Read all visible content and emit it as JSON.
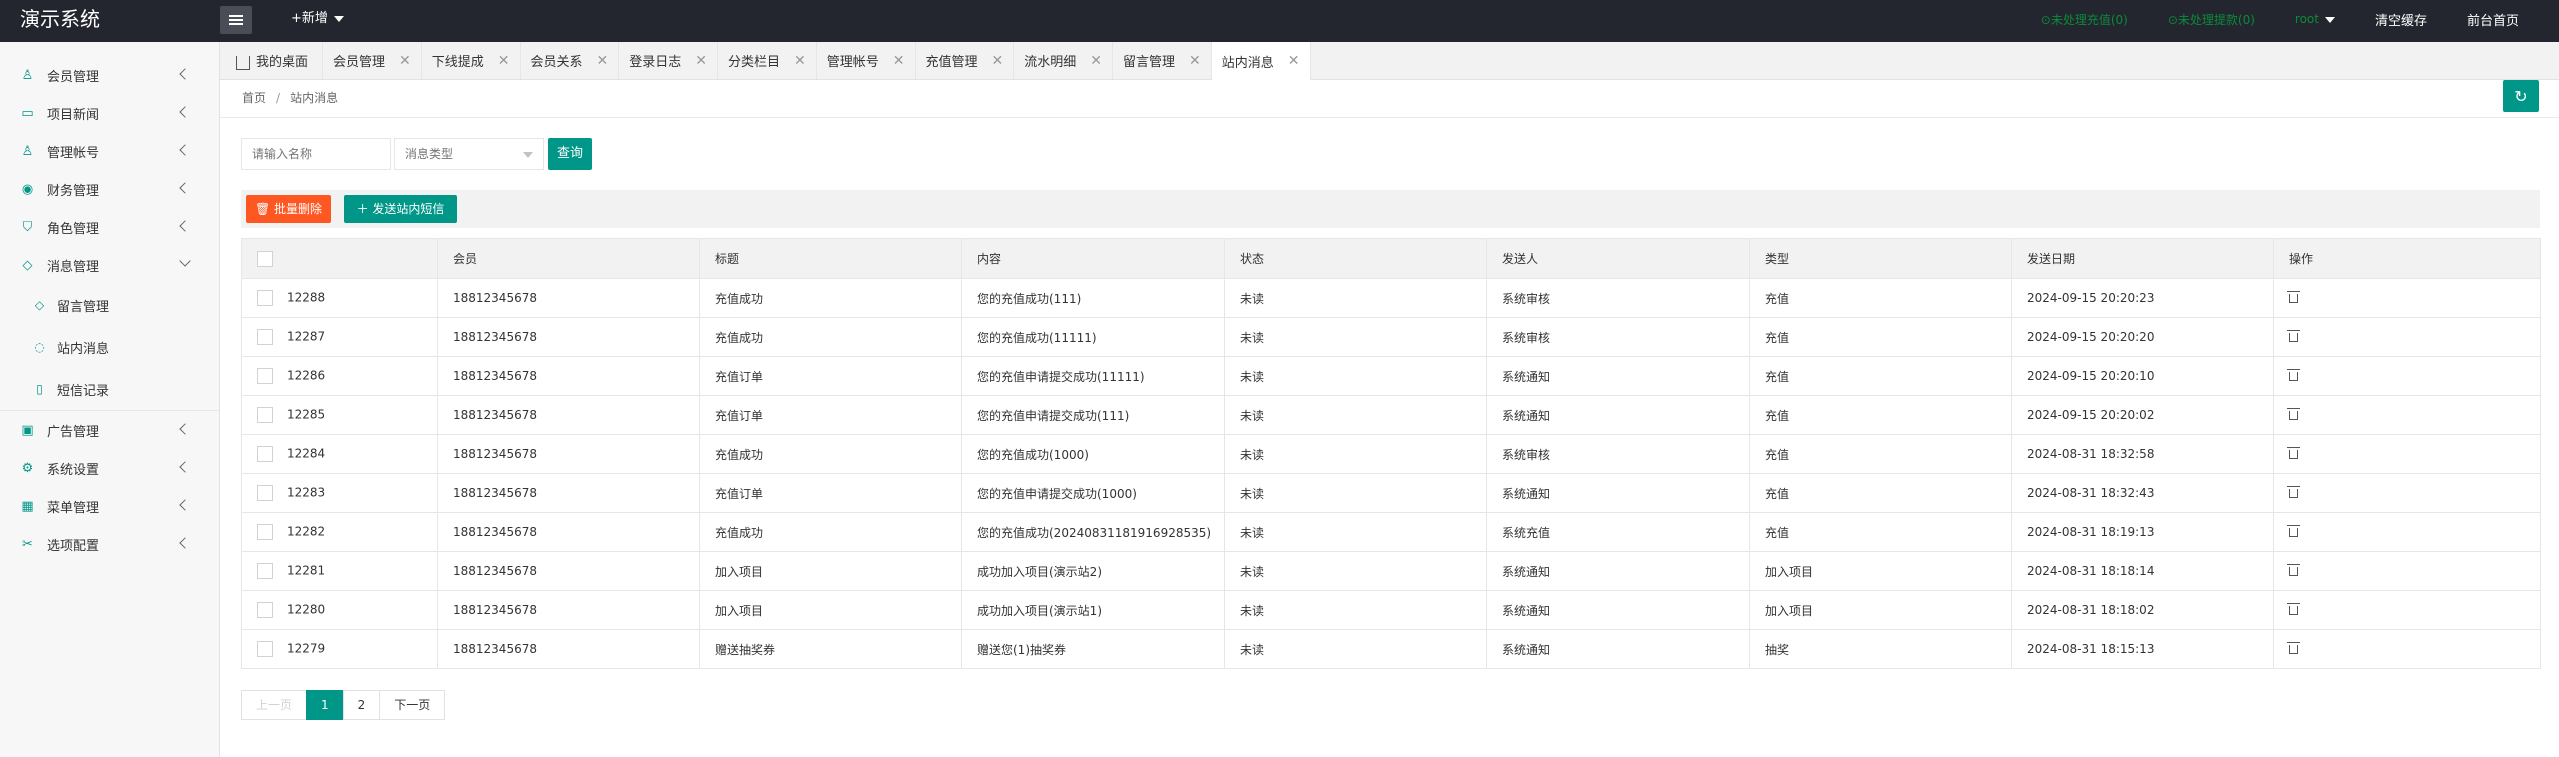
{
  "app": {
    "title": "演示系统"
  },
  "header": {
    "add_new_label": "+新增",
    "pending_recharge": "未处理充值(0)",
    "pending_withdraw": "未处理提款(0)",
    "user": "root",
    "clear_cache": "清空缓存",
    "frontend_home": "前台首页"
  },
  "sidebar": {
    "items": [
      {
        "label": "会员管理",
        "icon": "user-icon"
      },
      {
        "label": "项目新闻",
        "icon": "book-icon"
      },
      {
        "label": "管理帐号",
        "icon": "admin-icon"
      },
      {
        "label": "财务管理",
        "icon": "finance-icon"
      },
      {
        "label": "角色管理",
        "icon": "shield-icon"
      },
      {
        "label": "消息管理",
        "icon": "message-icon"
      }
    ],
    "sub_items": [
      {
        "label": "留言管理",
        "icon": "diamond-icon"
      },
      {
        "label": "站内消息",
        "icon": "chat-icon"
      },
      {
        "label": "短信记录",
        "icon": "phone-icon"
      }
    ],
    "items_after": [
      {
        "label": "广告管理",
        "icon": "image-icon"
      },
      {
        "label": "系统设置",
        "icon": "gear-icon"
      },
      {
        "label": "菜单管理",
        "icon": "menu-icon"
      },
      {
        "label": "选项配置",
        "icon": "tools-icon"
      }
    ]
  },
  "tabs": [
    {
      "label": "我的桌面"
    },
    {
      "label": "会员管理"
    },
    {
      "label": "下线提成"
    },
    {
      "label": "会员关系"
    },
    {
      "label": "登录日志"
    },
    {
      "label": "分类栏目"
    },
    {
      "label": "管理帐号"
    },
    {
      "label": "充值管理"
    },
    {
      "label": "流水明细"
    },
    {
      "label": "留言管理"
    },
    {
      "label": "站内消息"
    }
  ],
  "breadcrumb": {
    "home": "首页",
    "sep": "/",
    "current": "站内消息"
  },
  "search": {
    "name_placeholder": "请输入名称",
    "type_placeholder": "消息类型",
    "query_label": "查询"
  },
  "toolbar": {
    "batch_delete": "批量删除",
    "send_message": "发送站内短信"
  },
  "table": {
    "headers": [
      "",
      "会员",
      "标题",
      "内容",
      "状态",
      "发送人",
      "类型",
      "发送日期",
      "操作"
    ],
    "rows": [
      {
        "id": "12288",
        "member": "18812345678",
        "title": "充值成功",
        "content": "您的充值成功(111)",
        "status": "未读",
        "sender": "系统审核",
        "type": "充值",
        "date": "2024-09-15 20:20:23"
      },
      {
        "id": "12287",
        "member": "18812345678",
        "title": "充值成功",
        "content": "您的充值成功(11111)",
        "status": "未读",
        "sender": "系统审核",
        "type": "充值",
        "date": "2024-09-15 20:20:20"
      },
      {
        "id": "12286",
        "member": "18812345678",
        "title": "充值订单",
        "content": "您的充值申请提交成功(11111)",
        "status": "未读",
        "sender": "系统通知",
        "type": "充值",
        "date": "2024-09-15 20:20:10"
      },
      {
        "id": "12285",
        "member": "18812345678",
        "title": "充值订单",
        "content": "您的充值申请提交成功(111)",
        "status": "未读",
        "sender": "系统通知",
        "type": "充值",
        "date": "2024-09-15 20:20:02"
      },
      {
        "id": "12284",
        "member": "18812345678",
        "title": "充值成功",
        "content": "您的充值成功(1000)",
        "status": "未读",
        "sender": "系统审核",
        "type": "充值",
        "date": "2024-08-31 18:32:58"
      },
      {
        "id": "12283",
        "member": "18812345678",
        "title": "充值订单",
        "content": "您的充值申请提交成功(1000)",
        "status": "未读",
        "sender": "系统通知",
        "type": "充值",
        "date": "2024-08-31 18:32:43"
      },
      {
        "id": "12282",
        "member": "18812345678",
        "title": "充值成功",
        "content": "您的充值成功(20240831181916928535)",
        "status": "未读",
        "sender": "系统充值",
        "type": "充值",
        "date": "2024-08-31 18:19:13"
      },
      {
        "id": "12281",
        "member": "18812345678",
        "title": "加入项目",
        "content": "成功加入项目(演示站2)",
        "status": "未读",
        "sender": "系统通知",
        "type": "加入项目",
        "date": "2024-08-31 18:18:14"
      },
      {
        "id": "12280",
        "member": "18812345678",
        "title": "加入项目",
        "content": "成功加入项目(演示站1)",
        "status": "未读",
        "sender": "系统通知",
        "type": "加入项目",
        "date": "2024-08-31 18:18:02"
      },
      {
        "id": "12279",
        "member": "18812345678",
        "title": "赠送抽奖券",
        "content": "赠送您(1)抽奖券",
        "status": "未读",
        "sender": "系统通知",
        "type": "抽奖",
        "date": "2024-08-31 18:15:13"
      }
    ]
  },
  "pagination": {
    "prev": "上一页",
    "pages": [
      "1",
      "2"
    ],
    "current": "1",
    "next": "下一页"
  },
  "colors": {
    "primary": "#009688",
    "danger": "#ff5722",
    "header_bg": "#23262e",
    "notice_green": "#0b8a3a"
  }
}
